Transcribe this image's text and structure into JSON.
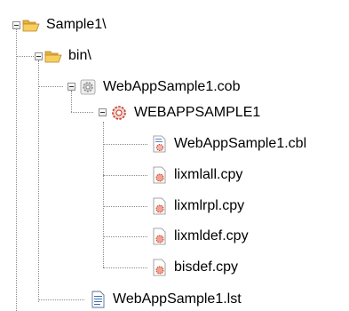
{
  "tree": {
    "root": {
      "label": "Sample1\\",
      "icon": "open-folder-icon"
    },
    "bin": {
      "label": "bin\\",
      "icon": "open-folder-icon"
    },
    "cob": {
      "label": "WebAppSample1.cob",
      "icon": "gear-project-icon"
    },
    "program": {
      "label": "WEBAPPSAMPLE1",
      "icon": "program-gear-icon"
    },
    "files": [
      {
        "label": "WebAppSample1.cbl",
        "icon": "source-file-icon"
      },
      {
        "label": "lixmlall.cpy",
        "icon": "copybook-file-icon"
      },
      {
        "label": "lixmlrpl.cpy",
        "icon": "copybook-file-icon"
      },
      {
        "label": "lixmldef.cpy",
        "icon": "copybook-file-icon"
      },
      {
        "label": "bisdef.cpy",
        "icon": "copybook-file-icon"
      }
    ],
    "lst": {
      "label": "WebAppSample1.lst",
      "icon": "text-document-icon"
    }
  },
  "colors": {
    "folder": "#f2c14e",
    "folder_dark": "#c9902a",
    "gear_red": "#d9534f",
    "tree_line": "#8a8a8a"
  }
}
